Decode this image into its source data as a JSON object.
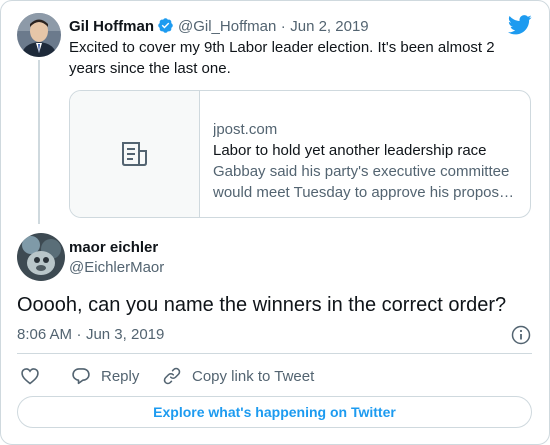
{
  "colors": {
    "accent": "#1d9bf0",
    "text": "#0f1419",
    "muted": "#536471",
    "border": "#cfd9de"
  },
  "parent_tweet": {
    "name": "Gil Hoffman",
    "verified_icon": "verified-badge-icon",
    "handle": "@Gil_Hoffman",
    "separator": "·",
    "date": "Jun 2, 2019",
    "text": "Excited to cover my 9th Labor leader election. It's been almost 2 years since the last one.",
    "link_card": {
      "thumb_icon": "article-icon",
      "domain": "jpost.com",
      "title": "Labor to hold yet another leadership race",
      "description": "Gabbay said his party's executive committee would meet Tuesday to approve his propos…"
    }
  },
  "reply_tweet": {
    "name": "maor eichler",
    "handle": "@EichlerMaor",
    "text": "Ooooh, can you name the winners in the correct order?",
    "time": "8:06 AM",
    "separator": "·",
    "date": "Jun 3, 2019",
    "info_icon": "info-icon"
  },
  "actions": {
    "like_icon": "heart-icon",
    "reply_icon": "reply-icon",
    "reply_label": "Reply",
    "copy_icon": "link-icon",
    "copy_label": "Copy link to Tweet"
  },
  "explore_label": "Explore what's happening on Twitter",
  "brand_icon": "twitter-bird-icon"
}
